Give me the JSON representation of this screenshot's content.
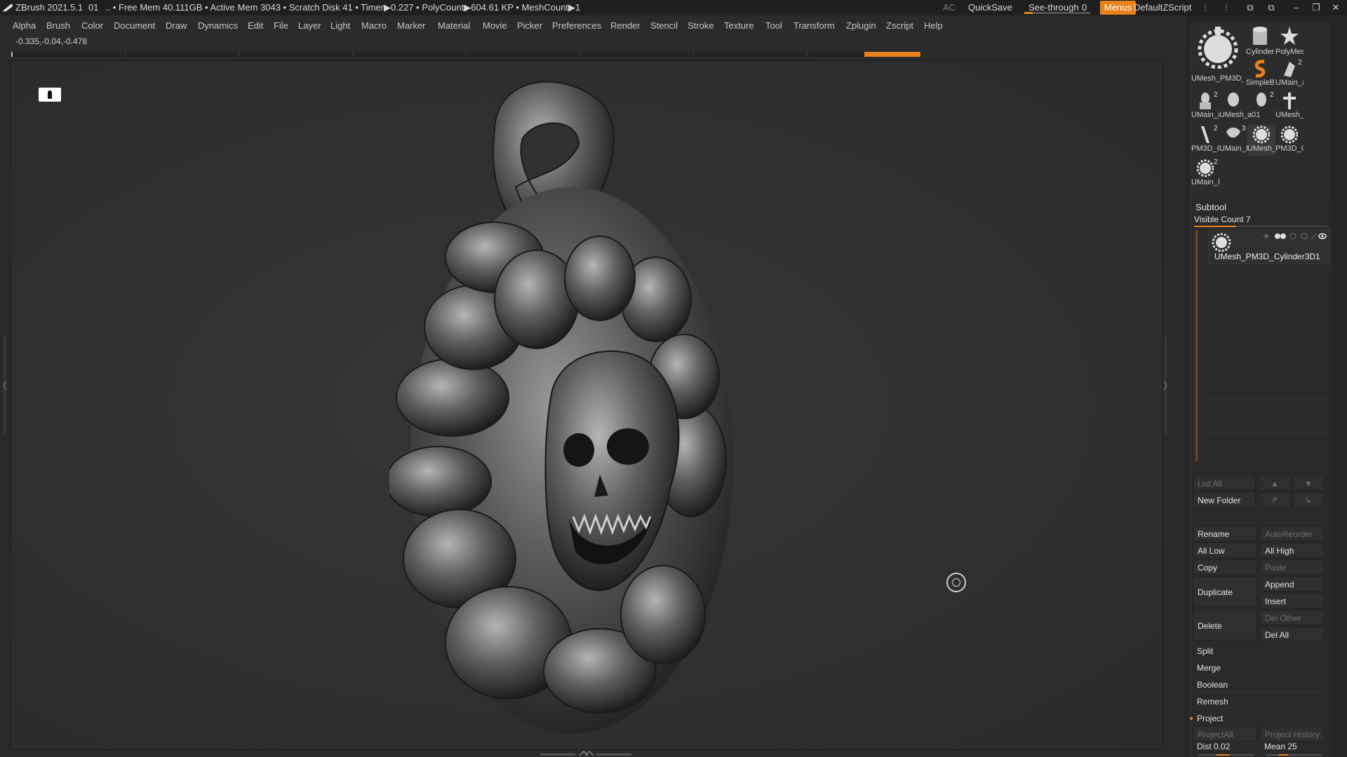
{
  "titlebar": {
    "app": "ZBrush 2021.5.1",
    "session": "01",
    "stats": ".. • Free Mem 40.111GB • Active Mem 3043 • Scratch Disk 41 •  Timer▶0.227 • PolyCount▶604.61 KP  • MeshCount▶1",
    "ac": "AC",
    "quicksave": "QuickSave",
    "seethrough_label": "See-through",
    "seethrough_value": "0",
    "menus": "Menus",
    "zscript": "DefaultZScript",
    "accent": "#e8801c"
  },
  "menubar": {
    "items": [
      "Alpha",
      "Brush",
      "Color",
      "Document",
      "Draw",
      "Dynamics",
      "Edit",
      "File",
      "Layer",
      "Light",
      "Macro",
      "Marker",
      "Material",
      "Movie",
      "Picker",
      "Preferences",
      "Render",
      "Stencil",
      "Stroke",
      "Texture",
      "Tool",
      "Transform",
      "Zplugin",
      "Zscript",
      "Help"
    ]
  },
  "coords": "-0.335,-0.04,-0.478",
  "tools": {
    "items": [
      {
        "label": "UMesh_PM3D_C",
        "icon": "large-gear-mesh-icon"
      },
      {
        "label": "Cylinder",
        "icon": "cylinder-icon"
      },
      {
        "label": "PolyMes",
        "icon": "star-mesh-icon"
      },
      {
        "label": "SimpleB",
        "icon": "simple-brush-icon"
      },
      {
        "label": "UMain_a",
        "icon": "mesh-thumb-icon",
        "count": "2"
      },
      {
        "label": "UMain_a",
        "icon": "mesh-thumb-icon",
        "count": "2"
      },
      {
        "label": "UMesh_",
        "icon": "mesh-thumb-icon"
      },
      {
        "label": "a01",
        "icon": "mesh-thumb-icon",
        "count": "2"
      },
      {
        "label": "UMesh_",
        "icon": "cross-mesh-icon"
      },
      {
        "label": "PM3D_C",
        "icon": "stick-mesh-icon",
        "count": "2"
      },
      {
        "label": "UMain_I",
        "icon": "mesh-thumb-icon",
        "count": "3"
      },
      {
        "label": "UMesh_",
        "icon": "gear-mesh-icon"
      },
      {
        "label": "PM3D_C",
        "icon": "gear-mesh-icon"
      },
      {
        "label": "UMain_I",
        "icon": "gear-mesh-icon",
        "count": "2"
      }
    ]
  },
  "subtool": {
    "header": "Subtool",
    "visible_count": "Visible Count 7",
    "active_name": "UMesh_PM3D_Cylinder3D1",
    "list_all": "List All",
    "new_folder": "New Folder",
    "rename": "Rename",
    "autoreorder": "AutoReorder",
    "all_low": "All Low",
    "all_high": "All High",
    "copy": "Copy",
    "paste": "Paste",
    "duplicate": "Duplicate",
    "append": "Append",
    "insert": "Insert",
    "delete": "Delete",
    "del_other": "Del Other",
    "del_all": "Del All",
    "split": "Split",
    "merge": "Merge",
    "boolean": "Boolean",
    "remesh": "Remesh",
    "project": "Project",
    "project_all": "ProjectAll",
    "project_history": "Project History",
    "dist_label": "Dist",
    "dist_value": "0.02",
    "mean_label": "Mean",
    "mean_value": "25"
  }
}
